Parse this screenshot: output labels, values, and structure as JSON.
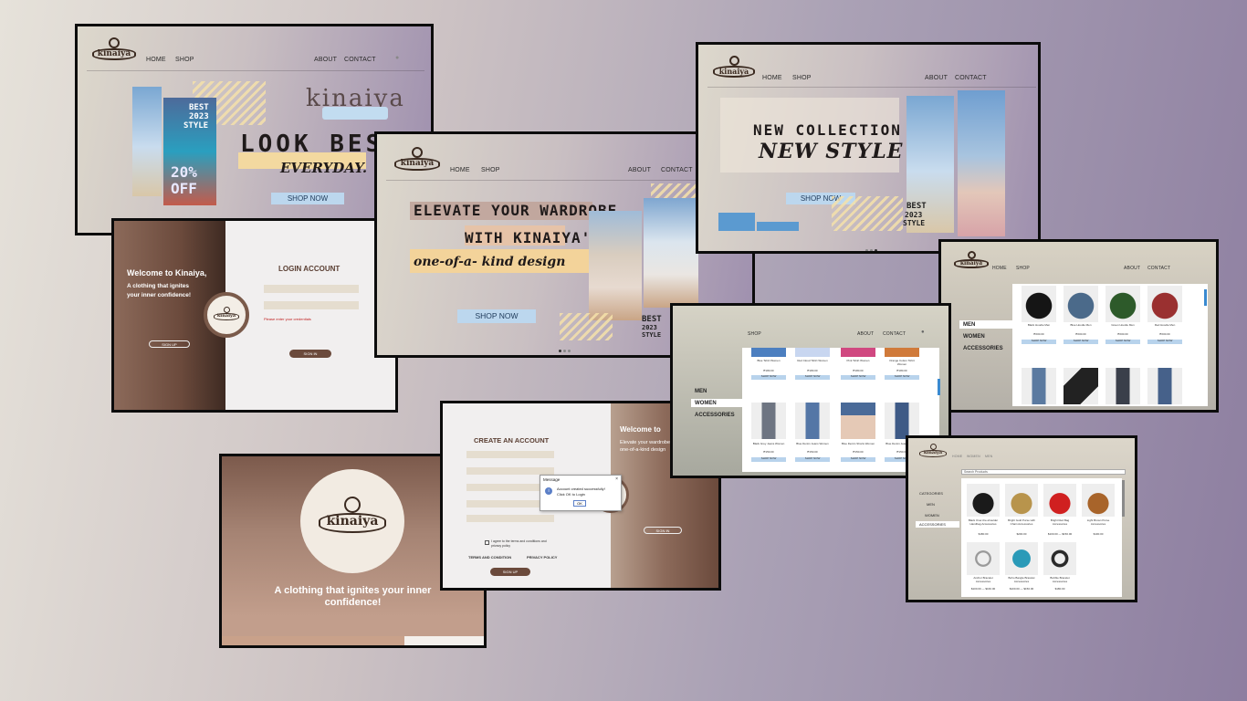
{
  "brand": "kinaiya",
  "colors": {
    "accent_blue": "#bcd7ee",
    "brown": "#6b4a3c",
    "beige": "#e5ddcf"
  },
  "nav": {
    "home": "HOME",
    "shop": "SHOP",
    "about": "ABOUT",
    "contact": "CONTACT",
    "men": "MEN",
    "women": "WOMEN"
  },
  "hero1": {
    "headline": "LOOK BEST",
    "tagline": "EVERYDAY.",
    "badge_line1": "BEST",
    "badge_line2": "2023",
    "badge_line3": "STYLE",
    "discount_1": "20%",
    "discount_2": "OFF",
    "cta": "SHOP NOW"
  },
  "hero2": {
    "line1": "ELEVATE YOUR WARDROBE",
    "line2": "WITH KINAIYA'S",
    "line3": "one-of-a- kind design",
    "badge_line1": "BEST",
    "badge_line2": "2023",
    "badge_line3": "STYLE",
    "cta": "SHOP NOW"
  },
  "hero3": {
    "line1": "NEW COLLECTION",
    "line2": "NEW STYLE",
    "badge_line1": "BEST",
    "badge_line2": "2023",
    "badge_line3": "STYLE",
    "cta": "SHOP NOW"
  },
  "login": {
    "welcome": "Welcome to Kinaiya,",
    "tagline_1": "A clothing that ignites",
    "tagline_2": "your inner confidence!",
    "title": "LOGIN ACCOUNT",
    "error": "Please enter your credentials",
    "signup_btn": "SIGN UP",
    "signin_btn": "SIGN IN"
  },
  "signup": {
    "title": "CREATE AN ACCOUNT",
    "welcome": "Welcome to",
    "side_1": "Elevate your wardrobe",
    "side_2": "one-of-a-kind design",
    "agree": "I agree to the terms and conditions and privacy policy",
    "terms": "TERMS AND CONDITION",
    "privacy": "PRIVACY POLICY",
    "signup_btn": "SIGN UP",
    "signin_btn": "SIGN IN",
    "dialog": {
      "title": "Message",
      "text_1": "Account created successfully!",
      "text_2": "Click OK to Login",
      "ok": "OK"
    }
  },
  "splash": {
    "tagline_1": "A clothing that ignites your inner",
    "tagline_2": "confidence!"
  },
  "shop_women": {
    "sidebar": [
      "MEN",
      "WOMEN",
      "ACCESSORIES"
    ],
    "about": "ABOUT",
    "contact": "CONTACT",
    "top_products": [
      "Blue Tshirt Women",
      "Red Cloud Tshirt Women",
      "Pink Tshirt Women",
      "Orange Cotton Tshirt Women"
    ],
    "top_prices": [
      "₱180.00",
      "₱180.00",
      "₱180.00",
      "₱180.00"
    ],
    "jeans": [
      "Black Grey Jeans Women",
      "Blue Denim Jeans Women",
      "Blue Denim Shorts Women",
      "Blue Denim Jeans Women"
    ],
    "jean_prices": [
      "₱150.00",
      "₱150.00",
      "₱150.00",
      "₱150.00"
    ],
    "shop_label": "SHOP NOW"
  },
  "shop_men": {
    "sidebar": [
      "MEN",
      "WOMEN",
      "ACCESSORIES"
    ],
    "hoodies": [
      "Black Hoodie Men",
      "Blue Hoodie Men",
      "Green Hoodie Men",
      "Red Hoodie Men"
    ],
    "prices": [
      "₱200.00",
      "₱200.00",
      "₱200.00",
      "₱200.00"
    ],
    "shop_label": "SHOP NOW"
  },
  "shop_acc": {
    "search": "Search Products",
    "sidebar": [
      "CATEGORIES",
      "MEN",
      "WOMEN",
      "ACCESSORIES"
    ],
    "nav": [
      "HOME",
      "WOMEN",
      "MEN"
    ],
    "items": [
      {
        "name": "Black Over-the-shoulder Handbag Accessories",
        "price": "$180.00"
      },
      {
        "name": "Bright Gold Purse with Chain Accessories",
        "price": "$200.00"
      },
      {
        "name": "Bright Red Bag Accessories",
        "price": "$100.00 — $150.00"
      },
      {
        "name": "Light Brown Purse Accessories",
        "price": "$100.00"
      },
      {
        "name": "Anchor Bracelet Accessories",
        "price": "$100.00 — $160.00"
      },
      {
        "name": "Boho Bangle Bracelet Accessories",
        "price": "$100.00 — $150.00"
      },
      {
        "name": "Bubble Bracelet Accessories",
        "price": "$180.00"
      }
    ]
  }
}
